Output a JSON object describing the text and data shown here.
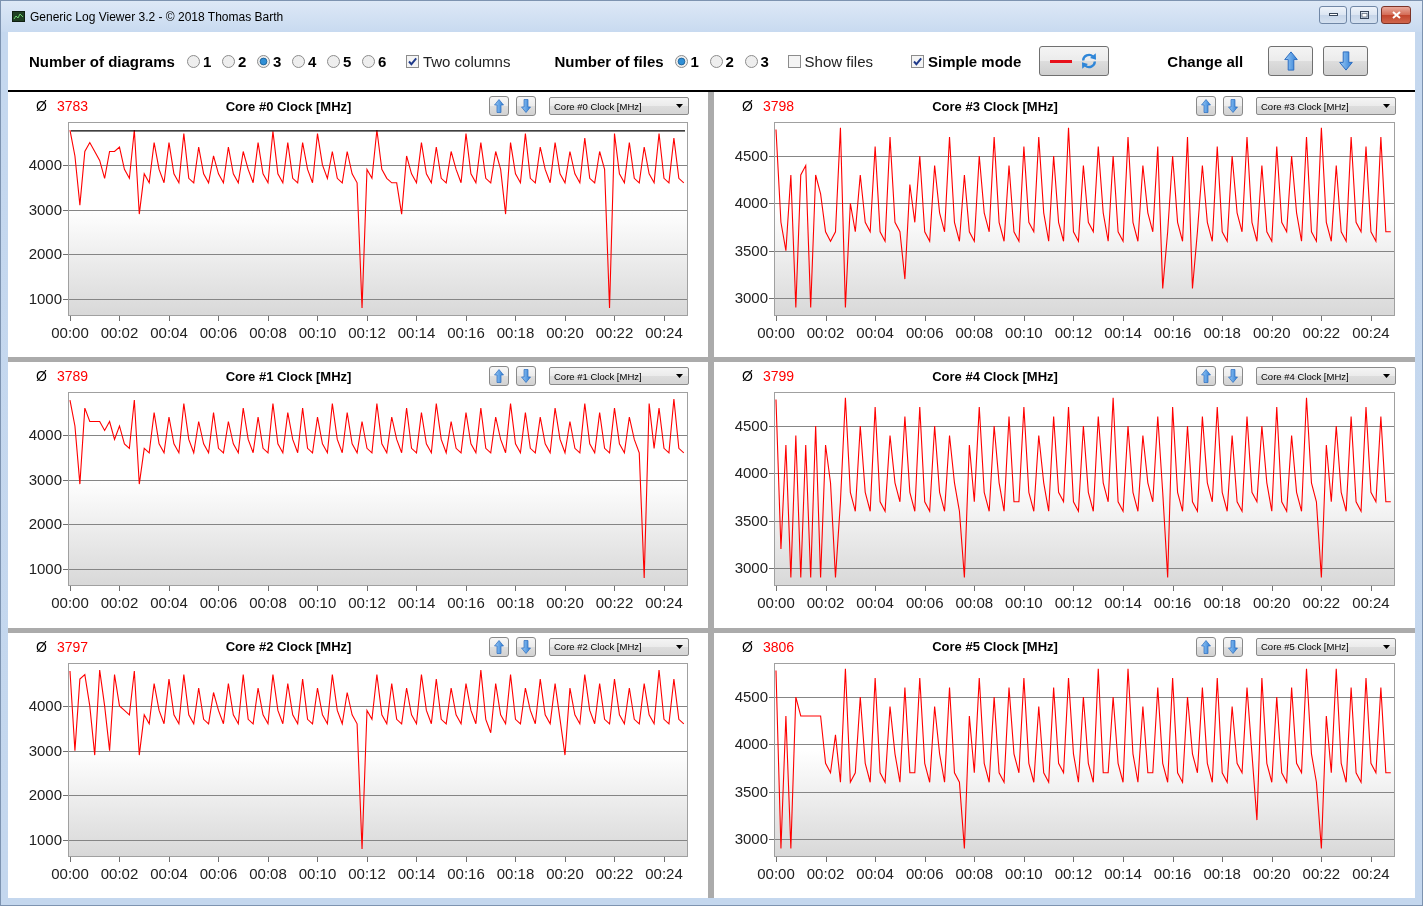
{
  "window": {
    "title": "Generic Log Viewer 3.2 - © 2018 Thomas Barth"
  },
  "toolbar": {
    "diagram_count": {
      "label": "Number of diagrams",
      "options": [
        {
          "label": "1",
          "selected": false
        },
        {
          "label": "2",
          "selected": false
        },
        {
          "label": "3",
          "selected": true
        },
        {
          "label": "4",
          "selected": false
        },
        {
          "label": "5",
          "selected": false
        },
        {
          "label": "6",
          "selected": false
        }
      ]
    },
    "two_columns": {
      "label": "Two columns",
      "checked": true
    },
    "file_count": {
      "label": "Number of files",
      "options": [
        {
          "label": "1",
          "selected": true
        },
        {
          "label": "2",
          "selected": false
        },
        {
          "label": "3",
          "selected": false
        }
      ]
    },
    "show_files": {
      "label": "Show files",
      "checked": false
    },
    "simple_mode": {
      "label": "Simple mode",
      "checked": true
    },
    "change_all": {
      "label": "Change all"
    }
  },
  "diagrams": [
    {
      "average_symbol": "Ø",
      "average": "3783",
      "selector": "Core #0 Clock [MHz]",
      "chart_data": {
        "type": "line",
        "title": "Core #0 Clock [MHz]",
        "x": [
          0,
          0.2,
          0.4,
          0.6,
          0.8,
          1,
          1.2,
          1.4,
          1.6,
          1.8,
          2,
          2.2,
          2.4,
          2.6,
          2.8,
          3,
          3.2,
          3.4,
          3.6,
          3.8,
          4,
          4.2,
          4.4,
          4.6,
          4.8,
          5,
          5.2,
          5.4,
          5.6,
          5.8,
          6,
          6.2,
          6.4,
          6.6,
          6.8,
          7,
          7.2,
          7.4,
          7.6,
          7.8,
          8,
          8.2,
          8.4,
          8.6,
          8.8,
          9,
          9.2,
          9.4,
          9.6,
          9.8,
          10,
          10.2,
          10.4,
          10.6,
          10.8,
          11,
          11.2,
          11.4,
          11.6,
          11.8,
          12,
          12.2,
          12.4,
          12.6,
          12.8,
          13,
          13.2,
          13.4,
          13.6,
          13.8,
          14,
          14.2,
          14.4,
          14.6,
          14.8,
          15,
          15.2,
          15.4,
          15.6,
          15.8,
          16,
          16.2,
          16.4,
          16.6,
          16.8,
          17,
          17.2,
          17.4,
          17.6,
          17.8,
          18,
          18.2,
          18.4,
          18.6,
          18.8,
          19,
          19.2,
          19.4,
          19.6,
          19.8,
          20,
          20.2,
          20.4,
          20.6,
          20.8,
          21,
          21.2,
          21.4,
          21.6,
          21.8,
          22,
          22.2,
          22.4,
          22.6,
          22.8,
          23,
          23.2,
          23.4,
          23.6,
          23.8,
          24,
          24.2,
          24.4,
          24.6,
          24.8
        ],
        "series": [
          {
            "color": "#ff0000",
            "values": [
              4780,
              4200,
              3100,
              4300,
              4500,
              4300,
              4100,
              3700,
              4300,
              4300,
              4400,
              3900,
              3700,
              4780,
              2900,
              3800,
              3600,
              4500,
              3900,
              3600,
              4500,
              3800,
              3600,
              4700,
              3700,
              3600,
              4400,
              3800,
              3600,
              4200,
              3800,
              3600,
              4400,
              3800,
              3600,
              4300,
              3900,
              3600,
              4500,
              3800,
              3600,
              4750,
              3800,
              3600,
              4500,
              3700,
              3600,
              4500,
              3900,
              3600,
              4700,
              4000,
              3700,
              4300,
              3700,
              3600,
              4300,
              3800,
              3600,
              800,
              3900,
              3700,
              4780,
              3900,
              3700,
              3600,
              3600,
              2900,
              4200,
              3800,
              3600,
              4500,
              3800,
              3600,
              4400,
              3700,
              3600,
              4300,
              3900,
              3600,
              4700,
              3800,
              3600,
              4500,
              3700,
              3600,
              4300,
              3900,
              2900,
              4500,
              3800,
              3600,
              4700,
              3700,
              3600,
              4400,
              3900,
              3600,
              4500,
              3800,
              3600,
              4300,
              3800,
              3600,
              4600,
              3700,
              3600,
              4300,
              3900,
              800,
              4700,
              3800,
              3600,
              4500,
              3700,
              3600,
              4400,
              3800,
              3600,
              4700,
              3700,
              3600,
              4600,
              3700,
              3600
            ]
          }
        ],
        "xlim": [
          -0.08,
          24.97
        ],
        "ylim": [
          620,
          4960
        ],
        "xticks": [
          {
            "value": 0,
            "label": "00:00"
          },
          {
            "value": 2,
            "label": "00:02"
          },
          {
            "value": 4,
            "label": "00:04"
          },
          {
            "value": 6,
            "label": "00:06"
          },
          {
            "value": 8,
            "label": "00:08"
          },
          {
            "value": 10,
            "label": "00:10"
          },
          {
            "value": 12,
            "label": "00:12"
          },
          {
            "value": 14,
            "label": "00:14"
          },
          {
            "value": 16,
            "label": "00:16"
          },
          {
            "value": 18,
            "label": "00:18"
          },
          {
            "value": 20,
            "label": "00:20"
          },
          {
            "value": 22,
            "label": "00:22"
          },
          {
            "value": 24,
            "label": "00:24"
          }
        ],
        "yticks": [
          1000,
          2000,
          3000,
          4000
        ],
        "grid": true,
        "ref_lines": [
          {
            "axis": "y",
            "value": 4760
          }
        ]
      }
    },
    {
      "average_symbol": "Ø",
      "average": "3798",
      "selector": "Core #3 Clock [MHz]",
      "chart_data": {
        "type": "line",
        "title": "Core #3 Clock [MHz]",
        "x": [
          0,
          0.2,
          0.4,
          0.6,
          0.8,
          1,
          1.2,
          1.4,
          1.6,
          1.8,
          2,
          2.2,
          2.4,
          2.6,
          2.8,
          3,
          3.2,
          3.4,
          3.6,
          3.8,
          4,
          4.2,
          4.4,
          4.6,
          4.8,
          5,
          5.2,
          5.4,
          5.6,
          5.8,
          6,
          6.2,
          6.4,
          6.6,
          6.8,
          7,
          7.2,
          7.4,
          7.6,
          7.8,
          8,
          8.2,
          8.4,
          8.6,
          8.8,
          9,
          9.2,
          9.4,
          9.6,
          9.8,
          10,
          10.2,
          10.4,
          10.6,
          10.8,
          11,
          11.2,
          11.4,
          11.6,
          11.8,
          12,
          12.2,
          12.4,
          12.6,
          12.8,
          13,
          13.2,
          13.4,
          13.6,
          13.8,
          14,
          14.2,
          14.4,
          14.6,
          14.8,
          15,
          15.2,
          15.4,
          15.6,
          15.8,
          16,
          16.2,
          16.4,
          16.6,
          16.8,
          17,
          17.2,
          17.4,
          17.6,
          17.8,
          18,
          18.2,
          18.4,
          18.6,
          18.8,
          19,
          19.2,
          19.4,
          19.6,
          19.8,
          20,
          20.2,
          20.4,
          20.6,
          20.8,
          21,
          21.2,
          21.4,
          21.6,
          21.8,
          22,
          22.2,
          22.4,
          22.6,
          22.8,
          23,
          23.2,
          23.4,
          23.6,
          23.8,
          24,
          24.2,
          24.4,
          24.6,
          24.8
        ],
        "series": [
          {
            "color": "#ff0000",
            "values": [
              4780,
              3800,
              3500,
              4300,
              2900,
              4300,
              4400,
              2900,
              4300,
              4100,
              3700,
              3600,
              3700,
              4800,
              2900,
              4000,
              3700,
              4300,
              3800,
              3700,
              4600,
              3700,
              3600,
              4700,
              3800,
              3700,
              3200,
              4200,
              3800,
              4500,
              3700,
              3600,
              4400,
              3900,
              3700,
              4700,
              3800,
              3600,
              4300,
              3700,
              3600,
              4500,
              3900,
              3700,
              4700,
              3800,
              3600,
              4400,
              3700,
              3600,
              4600,
              3800,
              3700,
              4700,
              3900,
              3600,
              4500,
              3800,
              3600,
              4800,
              3700,
              3600,
              4400,
              3800,
              3700,
              4600,
              3900,
              3600,
              4500,
              3700,
              3600,
              4700,
              3800,
              3600,
              4400,
              3900,
              3700,
              4600,
              3100,
              3700,
              4500,
              3800,
              3600,
              4700,
              3100,
              3700,
              4400,
              3800,
              3600,
              4600,
              3700,
              3600,
              4500,
              3900,
              3700,
              4700,
              3800,
              3600,
              4400,
              3700,
              3600,
              4600,
              3800,
              3700,
              4500,
              3900,
              3600,
              4700,
              3700,
              3600,
              4800,
              3800,
              3600,
              4400,
              3700,
              3600,
              4700,
              3800,
              3700,
              4600,
              3700,
              3600,
              4700,
              3700,
              3700
            ]
          }
        ],
        "xlim": [
          -0.08,
          24.97
        ],
        "ylim": [
          2810,
          4860
        ],
        "xticks": [
          {
            "value": 0,
            "label": "00:00"
          },
          {
            "value": 2,
            "label": "00:02"
          },
          {
            "value": 4,
            "label": "00:04"
          },
          {
            "value": 6,
            "label": "00:06"
          },
          {
            "value": 8,
            "label": "00:08"
          },
          {
            "value": 10,
            "label": "00:10"
          },
          {
            "value": 12,
            "label": "00:12"
          },
          {
            "value": 14,
            "label": "00:14"
          },
          {
            "value": 16,
            "label": "00:16"
          },
          {
            "value": 18,
            "label": "00:18"
          },
          {
            "value": 20,
            "label": "00:20"
          },
          {
            "value": 22,
            "label": "00:22"
          },
          {
            "value": 24,
            "label": "00:24"
          }
        ],
        "yticks": [
          3000,
          3500,
          4000,
          4500
        ],
        "grid": true
      }
    },
    {
      "average_symbol": "Ø",
      "average": "3789",
      "selector": "Core #1 Clock [MHz]",
      "chart_data": {
        "type": "line",
        "title": "Core #1 Clock [MHz]",
        "x": [
          0,
          0.2,
          0.4,
          0.6,
          0.8,
          1,
          1.2,
          1.4,
          1.6,
          1.8,
          2,
          2.2,
          2.4,
          2.6,
          2.8,
          3,
          3.2,
          3.4,
          3.6,
          3.8,
          4,
          4.2,
          4.4,
          4.6,
          4.8,
          5,
          5.2,
          5.4,
          5.6,
          5.8,
          6,
          6.2,
          6.4,
          6.6,
          6.8,
          7,
          7.2,
          7.4,
          7.6,
          7.8,
          8,
          8.2,
          8.4,
          8.6,
          8.8,
          9,
          9.2,
          9.4,
          9.6,
          9.8,
          10,
          10.2,
          10.4,
          10.6,
          10.8,
          11,
          11.2,
          11.4,
          11.6,
          11.8,
          12,
          12.2,
          12.4,
          12.6,
          12.8,
          13,
          13.2,
          13.4,
          13.6,
          13.8,
          14,
          14.2,
          14.4,
          14.6,
          14.8,
          15,
          15.2,
          15.4,
          15.6,
          15.8,
          16,
          16.2,
          16.4,
          16.6,
          16.8,
          17,
          17.2,
          17.4,
          17.6,
          17.8,
          18,
          18.2,
          18.4,
          18.6,
          18.8,
          19,
          19.2,
          19.4,
          19.6,
          19.8,
          20,
          20.2,
          20.4,
          20.6,
          20.8,
          21,
          21.2,
          21.4,
          21.6,
          21.8,
          22,
          22.2,
          22.4,
          22.6,
          22.8,
          23,
          23.2,
          23.4,
          23.6,
          23.8,
          24,
          24.2,
          24.4,
          24.6,
          24.8
        ],
        "series": [
          {
            "color": "#ff0000",
            "values": [
              4780,
              4200,
              2900,
              4600,
              4300,
              4300,
              4300,
              4100,
              4300,
              3900,
              4200,
              3800,
              3700,
              4780,
              2900,
              3700,
              3600,
              4500,
              3800,
              3600,
              4400,
              3800,
              3600,
              4700,
              3900,
              3600,
              4300,
              3800,
              3600,
              4500,
              3700,
              3600,
              4300,
              3800,
              3600,
              4600,
              3900,
              3600,
              4400,
              3700,
              3600,
              4700,
              3800,
              3600,
              4500,
              3900,
              3600,
              4600,
              3700,
              3600,
              4400,
              3800,
              3600,
              4700,
              3900,
              3600,
              4500,
              3800,
              3600,
              4300,
              3700,
              3600,
              4700,
              3800,
              3600,
              4400,
              3900,
              3600,
              4600,
              3700,
              3600,
              4500,
              3800,
              3600,
              4700,
              3900,
              3600,
              4300,
              3700,
              3600,
              4500,
              3800,
              3600,
              4600,
              3700,
              3600,
              4400,
              3900,
              3600,
              4700,
              3800,
              3600,
              4500,
              3700,
              3600,
              4400,
              3800,
              3600,
              4600,
              3900,
              3600,
              4300,
              3700,
              3600,
              4700,
              3800,
              3600,
              4500,
              3700,
              3600,
              4600,
              3800,
              3600,
              4400,
              3900,
              3600,
              800,
              4700,
              3700,
              4600,
              3700,
              3600,
              4800,
              3700,
              3600
            ]
          }
        ],
        "xlim": [
          -0.08,
          24.97
        ],
        "ylim": [
          620,
          4960
        ],
        "xticks": [
          {
            "value": 0,
            "label": "00:00"
          },
          {
            "value": 2,
            "label": "00:02"
          },
          {
            "value": 4,
            "label": "00:04"
          },
          {
            "value": 6,
            "label": "00:06"
          },
          {
            "value": 8,
            "label": "00:08"
          },
          {
            "value": 10,
            "label": "00:10"
          },
          {
            "value": 12,
            "label": "00:12"
          },
          {
            "value": 14,
            "label": "00:14"
          },
          {
            "value": 16,
            "label": "00:16"
          },
          {
            "value": 18,
            "label": "00:18"
          },
          {
            "value": 20,
            "label": "00:20"
          },
          {
            "value": 22,
            "label": "00:22"
          },
          {
            "value": 24,
            "label": "00:24"
          }
        ],
        "yticks": [
          1000,
          2000,
          3000,
          4000
        ],
        "grid": true
      }
    },
    {
      "average_symbol": "Ø",
      "average": "3799",
      "selector": "Core #4 Clock [MHz]",
      "chart_data": {
        "type": "line",
        "title": "Core #4 Clock [MHz]",
        "x": [
          0,
          0.2,
          0.4,
          0.6,
          0.8,
          1,
          1.2,
          1.4,
          1.6,
          1.8,
          2,
          2.2,
          2.4,
          2.6,
          2.8,
          3,
          3.2,
          3.4,
          3.6,
          3.8,
          4,
          4.2,
          4.4,
          4.6,
          4.8,
          5,
          5.2,
          5.4,
          5.6,
          5.8,
          6,
          6.2,
          6.4,
          6.6,
          6.8,
          7,
          7.2,
          7.4,
          7.6,
          7.8,
          8,
          8.2,
          8.4,
          8.6,
          8.8,
          9,
          9.2,
          9.4,
          9.6,
          9.8,
          10,
          10.2,
          10.4,
          10.6,
          10.8,
          11,
          11.2,
          11.4,
          11.6,
          11.8,
          12,
          12.2,
          12.4,
          12.6,
          12.8,
          13,
          13.2,
          13.4,
          13.6,
          13.8,
          14,
          14.2,
          14.4,
          14.6,
          14.8,
          15,
          15.2,
          15.4,
          15.6,
          15.8,
          16,
          16.2,
          16.4,
          16.6,
          16.8,
          17,
          17.2,
          17.4,
          17.6,
          17.8,
          18,
          18.2,
          18.4,
          18.6,
          18.8,
          19,
          19.2,
          19.4,
          19.6,
          19.8,
          20,
          20.2,
          20.4,
          20.6,
          20.8,
          21,
          21.2,
          21.4,
          21.6,
          21.8,
          22,
          22.2,
          22.4,
          22.6,
          22.8,
          23,
          23.2,
          23.4,
          23.6,
          23.8,
          24,
          24.2,
          24.4,
          24.6,
          24.8
        ],
        "series": [
          {
            "color": "#ff0000",
            "values": [
              4780,
              3200,
              4300,
              2900,
              4400,
              2900,
              4300,
              2900,
              4500,
              2900,
              4300,
              3900,
              2900,
              3700,
              4800,
              3800,
              3600,
              4500,
              3800,
              3600,
              4700,
              3700,
              3600,
              4400,
              3900,
              3700,
              4600,
              3800,
              3600,
              4700,
              3700,
              3600,
              4500,
              3800,
              3600,
              4400,
              3900,
              3600,
              2900,
              4300,
              3700,
              4700,
              3800,
              3600,
              4500,
              3900,
              3600,
              4600,
              3700,
              3700,
              4700,
              3800,
              3600,
              4400,
              3900,
              3600,
              4600,
              3800,
              3700,
              4700,
              3700,
              3600,
              4500,
              3800,
              3600,
              4600,
              3900,
              3700,
              4800,
              3700,
              3600,
              4500,
              3800,
              3600,
              4400,
              3900,
              3700,
              4600,
              3800,
              2900,
              4700,
              3800,
              3600,
              4500,
              3700,
              3600,
              4600,
              3900,
              3700,
              4700,
              3800,
              3600,
              4400,
              3700,
              3600,
              4600,
              3800,
              3700,
              4500,
              3900,
              3600,
              4700,
              3700,
              3600,
              4400,
              3800,
              3600,
              4800,
              3900,
              3700,
              2900,
              4300,
              3700,
              4500,
              3800,
              3600,
              4600,
              3700,
              3600,
              4700,
              3800,
              3700,
              4600,
              3700,
              3700
            ]
          }
        ],
        "xlim": [
          -0.08,
          24.97
        ],
        "ylim": [
          2810,
          4860
        ],
        "xticks": [
          {
            "value": 0,
            "label": "00:00"
          },
          {
            "value": 2,
            "label": "00:02"
          },
          {
            "value": 4,
            "label": "00:04"
          },
          {
            "value": 6,
            "label": "00:06"
          },
          {
            "value": 8,
            "label": "00:08"
          },
          {
            "value": 10,
            "label": "00:10"
          },
          {
            "value": 12,
            "label": "00:12"
          },
          {
            "value": 14,
            "label": "00:14"
          },
          {
            "value": 16,
            "label": "00:16"
          },
          {
            "value": 18,
            "label": "00:18"
          },
          {
            "value": 20,
            "label": "00:20"
          },
          {
            "value": 22,
            "label": "00:22"
          },
          {
            "value": 24,
            "label": "00:24"
          }
        ],
        "yticks": [
          3000,
          3500,
          4000,
          4500
        ],
        "grid": true
      }
    },
    {
      "average_symbol": "Ø",
      "average": "3797",
      "selector": "Core #2 Clock [MHz]",
      "chart_data": {
        "type": "line",
        "title": "Core #2 Clock [MHz]",
        "x": [
          0,
          0.2,
          0.4,
          0.6,
          0.8,
          1,
          1.2,
          1.4,
          1.6,
          1.8,
          2,
          2.2,
          2.4,
          2.6,
          2.8,
          3,
          3.2,
          3.4,
          3.6,
          3.8,
          4,
          4.2,
          4.4,
          4.6,
          4.8,
          5,
          5.2,
          5.4,
          5.6,
          5.8,
          6,
          6.2,
          6.4,
          6.6,
          6.8,
          7,
          7.2,
          7.4,
          7.6,
          7.8,
          8,
          8.2,
          8.4,
          8.6,
          8.8,
          9,
          9.2,
          9.4,
          9.6,
          9.8,
          10,
          10.2,
          10.4,
          10.6,
          10.8,
          11,
          11.2,
          11.4,
          11.6,
          11.8,
          12,
          12.2,
          12.4,
          12.6,
          12.8,
          13,
          13.2,
          13.4,
          13.6,
          13.8,
          14,
          14.2,
          14.4,
          14.6,
          14.8,
          15,
          15.2,
          15.4,
          15.6,
          15.8,
          16,
          16.2,
          16.4,
          16.6,
          16.8,
          17,
          17.2,
          17.4,
          17.6,
          17.8,
          18,
          18.2,
          18.4,
          18.6,
          18.8,
          19,
          19.2,
          19.4,
          19.6,
          19.8,
          20,
          20.2,
          20.4,
          20.6,
          20.8,
          21,
          21.2,
          21.4,
          21.6,
          21.8,
          22,
          22.2,
          22.4,
          22.6,
          22.8,
          23,
          23.2,
          23.4,
          23.6,
          23.8,
          24,
          24.2,
          24.4,
          24.6,
          24.8
        ],
        "series": [
          {
            "color": "#ff0000",
            "values": [
              4780,
              3000,
              4600,
              4700,
              4000,
              2900,
              4800,
              4000,
              3000,
              4700,
              4000,
              3900,
              3800,
              4780,
              2900,
              3800,
              3600,
              4500,
              3900,
              3600,
              4600,
              3800,
              3600,
              4700,
              3800,
              3600,
              4400,
              3700,
              3600,
              4300,
              3900,
              3600,
              4500,
              3800,
              3600,
              4700,
              3700,
              3600,
              4400,
              3800,
              3600,
              4700,
              3900,
              3600,
              4500,
              3800,
              3600,
              4600,
              3700,
              3600,
              4400,
              3800,
              3600,
              4700,
              3900,
              3600,
              4300,
              3800,
              3600,
              800,
              3900,
              3700,
              4700,
              3800,
              3600,
              4500,
              3700,
              3600,
              4400,
              3800,
              3600,
              4700,
              3900,
              3600,
              4600,
              3700,
              3600,
              4400,
              3800,
              3600,
              4500,
              3900,
              3600,
              4800,
              3700,
              3400,
              4500,
              3800,
              3600,
              4700,
              3700,
              3600,
              4400,
              3900,
              3600,
              4600,
              3800,
              3600,
              4500,
              3700,
              2900,
              4400,
              3800,
              3600,
              4700,
              3900,
              3600,
              4500,
              3700,
              3600,
              4600,
              3800,
              3600,
              4400,
              3700,
              3600,
              4500,
              3800,
              3600,
              4800,
              3700,
              3600,
              4600,
              3700,
              3600
            ]
          }
        ],
        "xlim": [
          -0.08,
          24.97
        ],
        "ylim": [
          620,
          4960
        ],
        "xticks": [
          {
            "value": 0,
            "label": "00:00"
          },
          {
            "value": 2,
            "label": "00:02"
          },
          {
            "value": 4,
            "label": "00:04"
          },
          {
            "value": 6,
            "label": "00:06"
          },
          {
            "value": 8,
            "label": "00:08"
          },
          {
            "value": 10,
            "label": "00:10"
          },
          {
            "value": 12,
            "label": "00:12"
          },
          {
            "value": 14,
            "label": "00:14"
          },
          {
            "value": 16,
            "label": "00:16"
          },
          {
            "value": 18,
            "label": "00:18"
          },
          {
            "value": 20,
            "label": "00:20"
          },
          {
            "value": 22,
            "label": "00:22"
          },
          {
            "value": 24,
            "label": "00:24"
          }
        ],
        "yticks": [
          1000,
          2000,
          3000,
          4000
        ],
        "grid": true
      }
    },
    {
      "average_symbol": "Ø",
      "average": "3806",
      "selector": "Core #5 Clock [MHz]",
      "chart_data": {
        "type": "line",
        "title": "Core #5 Clock [MHz]",
        "x": [
          0,
          0.2,
          0.4,
          0.6,
          0.8,
          1,
          1.2,
          1.4,
          1.6,
          1.8,
          2,
          2.2,
          2.4,
          2.6,
          2.8,
          3,
          3.2,
          3.4,
          3.6,
          3.8,
          4,
          4.2,
          4.4,
          4.6,
          4.8,
          5,
          5.2,
          5.4,
          5.6,
          5.8,
          6,
          6.2,
          6.4,
          6.6,
          6.8,
          7,
          7.2,
          7.4,
          7.6,
          7.8,
          8,
          8.2,
          8.4,
          8.6,
          8.8,
          9,
          9.2,
          9.4,
          9.6,
          9.8,
          10,
          10.2,
          10.4,
          10.6,
          10.8,
          11,
          11.2,
          11.4,
          11.6,
          11.8,
          12,
          12.2,
          12.4,
          12.6,
          12.8,
          13,
          13.2,
          13.4,
          13.6,
          13.8,
          14,
          14.2,
          14.4,
          14.6,
          14.8,
          15,
          15.2,
          15.4,
          15.6,
          15.8,
          16,
          16.2,
          16.4,
          16.6,
          16.8,
          17,
          17.2,
          17.4,
          17.6,
          17.8,
          18,
          18.2,
          18.4,
          18.6,
          18.8,
          19,
          19.2,
          19.4,
          19.6,
          19.8,
          20,
          20.2,
          20.4,
          20.6,
          20.8,
          21,
          21.2,
          21.4,
          21.6,
          21.8,
          22,
          22.2,
          22.4,
          22.6,
          22.8,
          23,
          23.2,
          23.4,
          23.6,
          23.8,
          24,
          24.2,
          24.4,
          24.6,
          24.8
        ],
        "series": [
          {
            "color": "#ff0000",
            "values": [
              4780,
              2900,
              4300,
              2900,
              4500,
              4300,
              4300,
              4300,
              4300,
              4300,
              3800,
              3700,
              4100,
              3600,
              4800,
              3600,
              3700,
              4500,
              3800,
              3600,
              4700,
              3700,
              3600,
              4400,
              3900,
              3600,
              4600,
              3700,
              3700,
              4700,
              3800,
              3600,
              4400,
              3900,
              3600,
              4600,
              3700,
              3600,
              2900,
              4300,
              3700,
              4700,
              3800,
              3600,
              4500,
              3700,
              3600,
              4600,
              3900,
              3700,
              4700,
              3800,
              3600,
              4400,
              3700,
              3600,
              4600,
              3800,
              3700,
              4700,
              3900,
              3600,
              4500,
              3800,
              3600,
              4800,
              3700,
              3700,
              4500,
              3800,
              3600,
              4800,
              3900,
              3600,
              4400,
              3700,
              3700,
              4600,
              3800,
              3600,
              4700,
              3700,
              3600,
              4500,
              3900,
              3700,
              4600,
              3800,
              3600,
              4700,
              3700,
              3600,
              4400,
              3800,
              3700,
              4600,
              3900,
              3200,
              4700,
              3800,
              3600,
              4500,
              3700,
              3600,
              4600,
              3800,
              3700,
              4800,
              3900,
              3600,
              2900,
              4300,
              3700,
              4800,
              3800,
              3600,
              4600,
              3700,
              3600,
              4700,
              3800,
              3700,
              4600,
              3700,
              3700
            ]
          }
        ],
        "xlim": [
          -0.08,
          24.97
        ],
        "ylim": [
          2810,
          4860
        ],
        "xticks": [
          {
            "value": 0,
            "label": "00:00"
          },
          {
            "value": 2,
            "label": "00:02"
          },
          {
            "value": 4,
            "label": "00:04"
          },
          {
            "value": 6,
            "label": "00:06"
          },
          {
            "value": 8,
            "label": "00:08"
          },
          {
            "value": 10,
            "label": "00:10"
          },
          {
            "value": 12,
            "label": "00:12"
          },
          {
            "value": 14,
            "label": "00:14"
          },
          {
            "value": 16,
            "label": "00:16"
          },
          {
            "value": 18,
            "label": "00:18"
          },
          {
            "value": 20,
            "label": "00:20"
          },
          {
            "value": 22,
            "label": "00:22"
          },
          {
            "value": 24,
            "label": "00:24"
          }
        ],
        "yticks": [
          3000,
          3500,
          4000,
          4500
        ],
        "grid": true
      }
    }
  ]
}
